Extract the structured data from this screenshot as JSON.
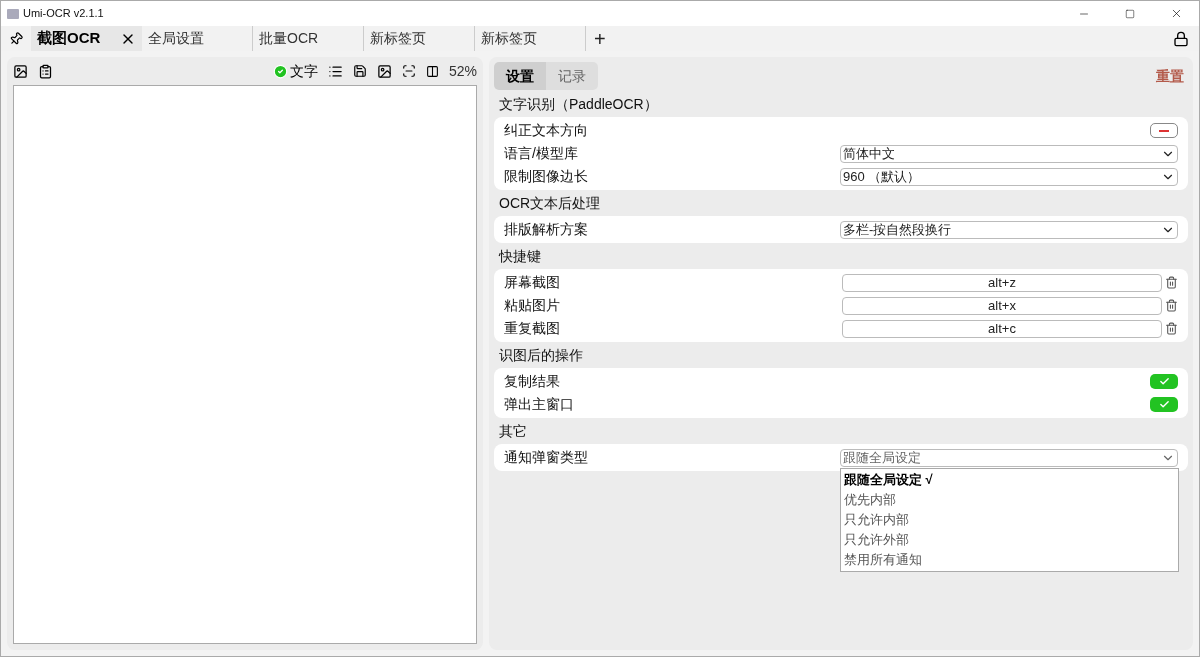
{
  "window": {
    "title": "Umi-OCR v2.1.1"
  },
  "tabs": [
    {
      "label": "截图OCR",
      "selected": true,
      "closable": true
    },
    {
      "label": "全局设置",
      "selected": false,
      "closable": false
    },
    {
      "label": "批量OCR",
      "selected": false,
      "closable": false
    },
    {
      "label": "新标签页",
      "selected": false,
      "closable": false
    },
    {
      "label": "新标签页",
      "selected": false,
      "closable": false
    }
  ],
  "add_tab": "+",
  "preview": {
    "text_toggle": {
      "label": "文字",
      "checked": true
    },
    "zoom": "52%"
  },
  "settings_tabs": [
    {
      "label": "设置",
      "selected": true
    },
    {
      "label": "记录",
      "selected": false
    }
  ],
  "reset": "重置",
  "groups": [
    {
      "title": "文字识别（PaddleOCR）",
      "rows": [
        {
          "kind": "toggle",
          "label": "纠正文本方向",
          "on": false
        },
        {
          "kind": "select",
          "label": "语言/模型库",
          "value": "简体中文",
          "open": false
        },
        {
          "kind": "select",
          "label": "限制图像边长",
          "value": "960 （默认）",
          "open": false
        }
      ]
    },
    {
      "title": "OCR文本后处理",
      "rows": [
        {
          "kind": "select",
          "label": "排版解析方案",
          "value": "多栏-按自然段换行",
          "open": false
        }
      ]
    },
    {
      "title": "快捷键",
      "rows": [
        {
          "kind": "hotkey",
          "label": "屏幕截图",
          "value": "alt+z"
        },
        {
          "kind": "hotkey",
          "label": "粘贴图片",
          "value": "alt+x"
        },
        {
          "kind": "hotkey",
          "label": "重复截图",
          "value": "alt+c"
        }
      ]
    },
    {
      "title": "识图后的操作",
      "rows": [
        {
          "kind": "toggle",
          "label": "复制结果",
          "on": true
        },
        {
          "kind": "toggle",
          "label": "弹出主窗口",
          "on": true
        }
      ]
    },
    {
      "title": "其它",
      "rows": [
        {
          "kind": "select",
          "label": "通知弹窗类型",
          "value": "跟随全局设定",
          "open": true
        }
      ]
    }
  ],
  "dropdown": {
    "check_mark": "√",
    "options": [
      {
        "label": "跟随全局设定",
        "selected": true
      },
      {
        "label": "优先内部",
        "selected": false
      },
      {
        "label": "只允许内部",
        "selected": false
      },
      {
        "label": "只允许外部",
        "selected": false
      },
      {
        "label": "禁用所有通知",
        "selected": false
      }
    ]
  }
}
